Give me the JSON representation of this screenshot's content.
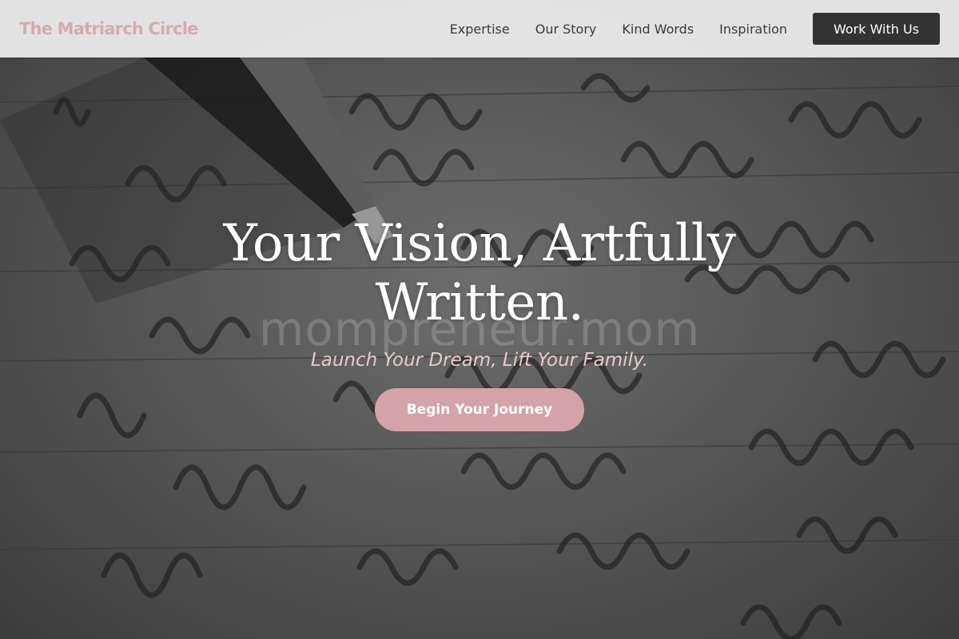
{
  "nav": {
    "brand": "The Matriarch Circle",
    "links": [
      "Expertise",
      "Our Story",
      "Kind Words",
      "Inspiration"
    ],
    "cta_label": "Work With Us"
  },
  "hero": {
    "headline": "Your Vision, Artfully Written.",
    "watermark": "mompreneur.mom",
    "subheadline": "Launch Your Dream, Lift Your Family.",
    "button_label": "Begin Your Journey"
  },
  "colors": {
    "brand_pink": "#d8a9ad",
    "button_pink": "#d4a3a7",
    "subheadline_pink": "#e8c8cb",
    "cta_dark": "#333333"
  },
  "icons": []
}
